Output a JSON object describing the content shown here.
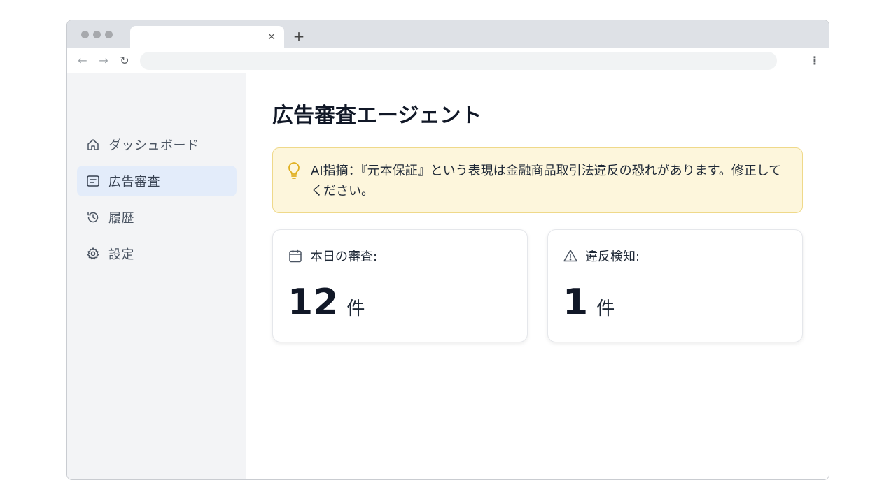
{
  "browser": {
    "tab_close_glyph": "×",
    "new_tab_glyph": "+",
    "back_glyph": "←",
    "forward_glyph": "→",
    "reload_glyph": "↻",
    "menu_glyph": "⋮"
  },
  "sidebar": {
    "items": [
      {
        "label": "ダッシュボード",
        "icon": "home-icon",
        "active": false
      },
      {
        "label": "広告審査",
        "icon": "document-list-icon",
        "active": true
      },
      {
        "label": "履歴",
        "icon": "history-icon",
        "active": false
      },
      {
        "label": "設定",
        "icon": "gear-icon",
        "active": false
      }
    ]
  },
  "main": {
    "title": "広告審査エージェント",
    "alert": {
      "icon": "lightbulb-icon",
      "text": "AI指摘：『元本保証』という表現は金融商品取引法違反の恐れがあります。修正してください。"
    },
    "cards": [
      {
        "icon": "calendar-icon",
        "label": "本日の審査:",
        "value": "12",
        "unit": "件"
      },
      {
        "icon": "warning-icon",
        "label": "違反検知:",
        "value": "1",
        "unit": "件"
      }
    ]
  },
  "colors": {
    "sidebar_bg": "#f3f4f6",
    "active_item_bg": "#e3ecfa",
    "alert_bg": "#fdf6dc",
    "alert_border": "#efd98a",
    "alert_icon": "#e0b020"
  }
}
